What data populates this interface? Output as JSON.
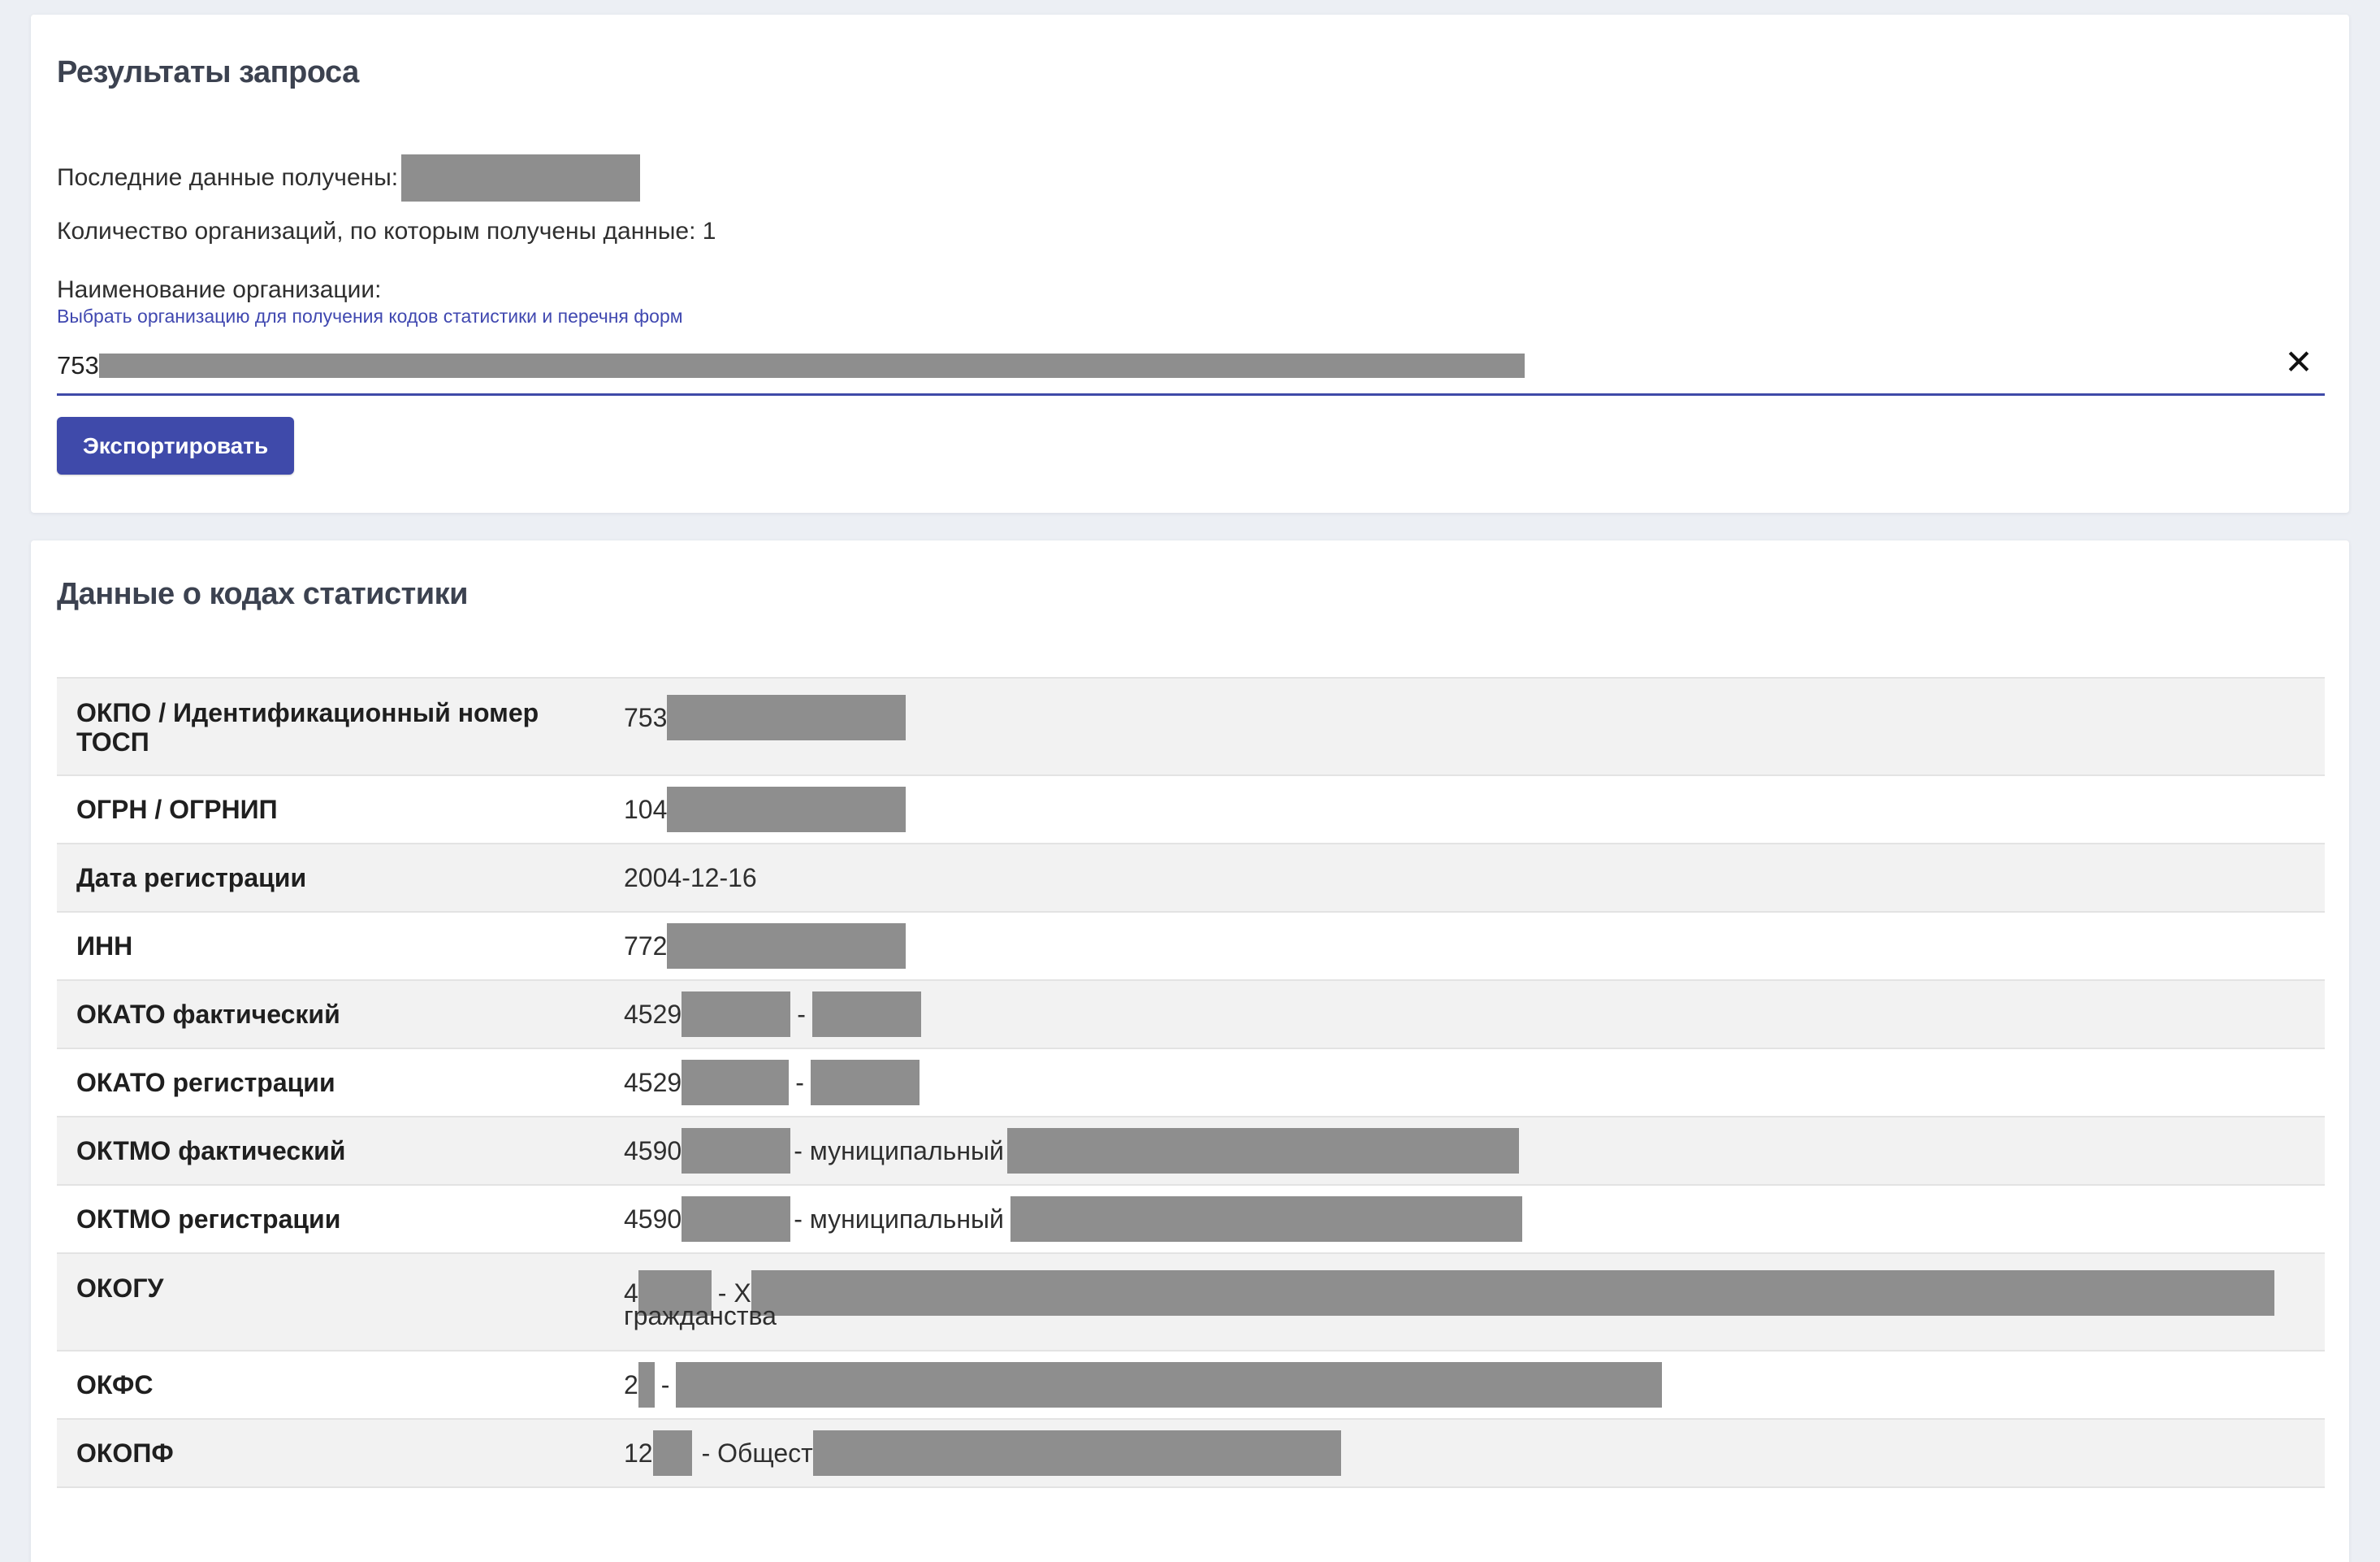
{
  "results_card": {
    "title": "Результаты запроса",
    "last_data_label": "Последние данные получены:",
    "org_count_text": "Количество организаций, по которым получены данные: 1",
    "org_field_label": "Наименование организации:",
    "org_field_hint": "Выбрать организацию для получения кодов статистики и перечня форм",
    "org_field_value_prefix": "753",
    "clear_icon_glyph": "✕",
    "export_label": "Экспортировать"
  },
  "codes_card": {
    "title": "Данные о кодах статистики",
    "rows": [
      {
        "key": "ОКПО / Идентификационный номер ТОСП",
        "prefix": "753"
      },
      {
        "key": "ОГРН / ОГРНИП",
        "prefix": "104"
      },
      {
        "key": "Дата регистрации",
        "value": "2004-12-16"
      },
      {
        "key": "ИНН",
        "prefix": "772"
      },
      {
        "key": "ОКАТО фактический",
        "prefix": "4529",
        "separator": "-"
      },
      {
        "key": "ОКАТО регистрации",
        "prefix": "4529",
        "separator": "-"
      },
      {
        "key": "ОКТМО фактический",
        "prefix": "4590",
        "middle": "- муниципальный"
      },
      {
        "key": "ОКТМО регистрации",
        "prefix": "4590",
        "middle": "- муниципальный"
      },
      {
        "key": "ОКОГУ",
        "prefix": "4",
        "separator": "- Х",
        "second_line": "гражданства"
      },
      {
        "key": "ОКФС",
        "prefix": "2",
        "separator": "-"
      },
      {
        "key": "ОКОПФ",
        "prefix": "12",
        "middle": "- Общест"
      }
    ]
  },
  "colors": {
    "accent": "#3f4aaa",
    "redaction": "#8e8e8e",
    "background": "#eceff4",
    "row_alt": "#f2f2f2"
  }
}
